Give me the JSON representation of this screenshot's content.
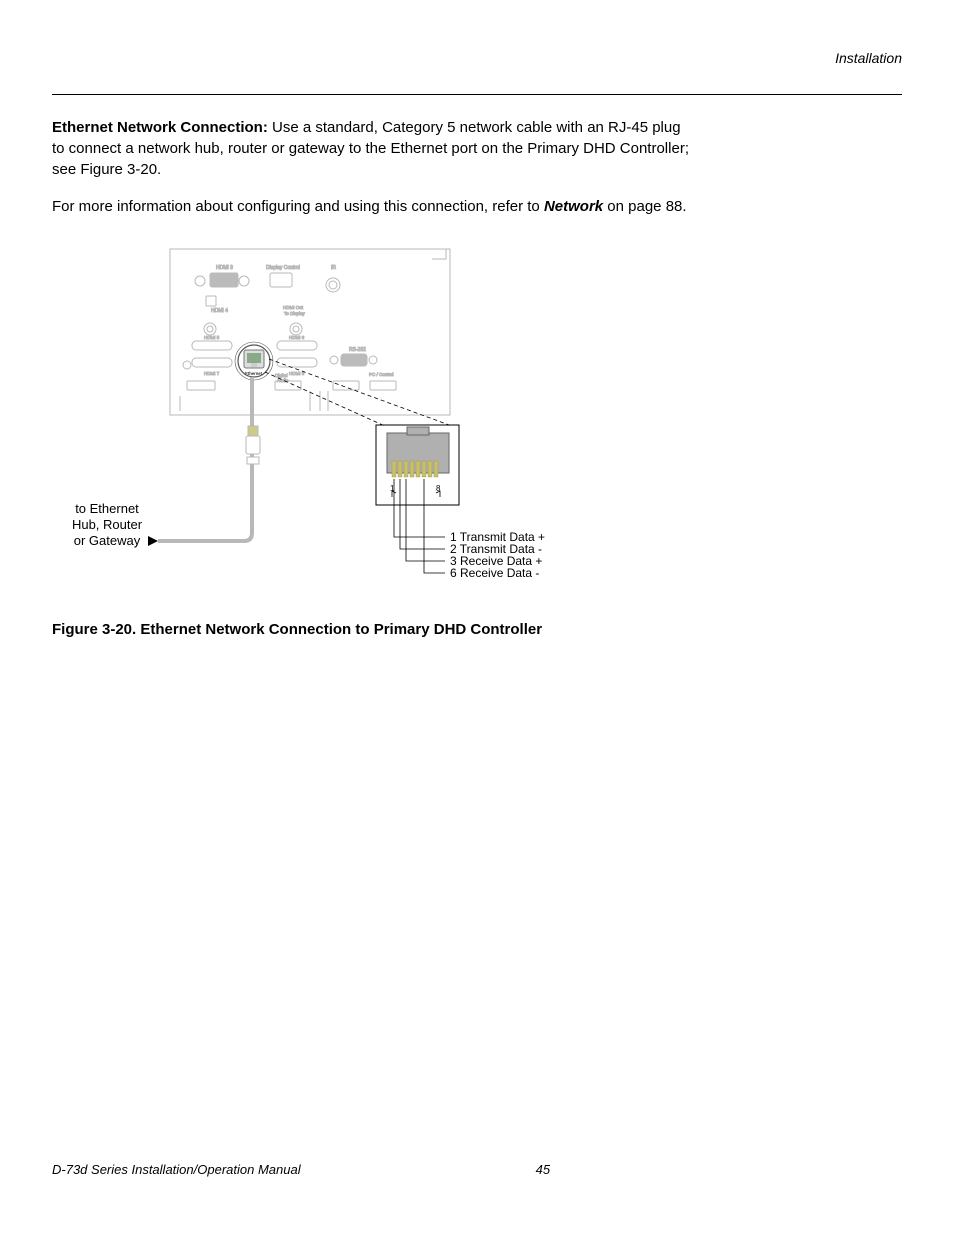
{
  "header": {
    "section": "Installation"
  },
  "para1": {
    "lead": "Ethernet Network Connection:",
    "rest": " Use a standard, Category 5 network cable with an RJ-45 plug to connect a network hub, router or gateway to the Ethernet port on the Primary DHD Controller; see Figure 3-20."
  },
  "para2": {
    "pre": "For more information about configuring and using this connection, refer to ",
    "link": "Network",
    "post": " on page 88."
  },
  "figure_caption": "Figure 3-20. Ethernet Network Connection to Primary DHD Controller",
  "diagram": {
    "left_label_l1": "to Ethernet",
    "left_label_l2": "Hub, Router",
    "left_label_l3": "or Gateway",
    "pin1": "1 Transmit Data +",
    "pin2": "2 Transmit Data -",
    "pin3": "3 Receive Data +",
    "pin6": "6 Receive Data -",
    "pin_inner_1": "1",
    "pin_inner_8": "8",
    "ports": {
      "hdmi3": "HDMI 3",
      "hdmi4": "HDMI 4",
      "hdmi5": "HDMI 5",
      "hdmi6": "HDMI 6",
      "hdmi7": "HDMI 7",
      "hdmi8": "HDMI 8",
      "display_control": "Display Control",
      "hdmi_out_to_display": "HDMI Out\nTo Display",
      "ir": "IR",
      "rs232": "RS-232",
      "pc_control": "PC / Control",
      "ethernet": "Ethernet",
      "digital_audio": "Digital\nAudio"
    }
  },
  "footer": {
    "title": "D-73d Series Installation/Operation Manual",
    "page": "45"
  }
}
